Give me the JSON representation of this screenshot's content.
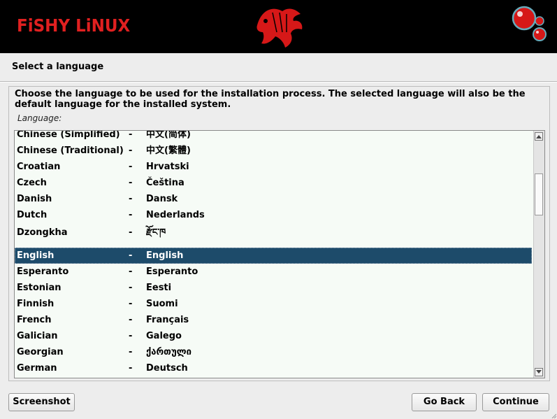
{
  "banner": {
    "brand": "FiSHY LiNUX",
    "logo_icon": "betta-fish-icon",
    "bubbles_icon": "bubbles-icon",
    "accent_color": "#e02020"
  },
  "page": {
    "title": "Select a language",
    "description": "Choose the language to be used for the installation process. The selected language will also be the default language for the installed system.",
    "field_label": "Language:"
  },
  "languages": [
    {
      "name": "Chinese (Simplified)",
      "native": "中文(简体)"
    },
    {
      "name": "Chinese (Traditional)",
      "native": "中文(繁體)"
    },
    {
      "name": "Croatian",
      "native": "Hrvatski"
    },
    {
      "name": "Czech",
      "native": "Čeština"
    },
    {
      "name": "Danish",
      "native": "Dansk"
    },
    {
      "name": "Dutch",
      "native": "Nederlands"
    },
    {
      "name": "Dzongkha",
      "native": "རྫོང་ཁ"
    },
    {
      "name": "English",
      "native": "English",
      "selected": true
    },
    {
      "name": "Esperanto",
      "native": "Esperanto"
    },
    {
      "name": "Estonian",
      "native": "Eesti"
    },
    {
      "name": "Finnish",
      "native": "Suomi"
    },
    {
      "name": "French",
      "native": "Français"
    },
    {
      "name": "Galician",
      "native": "Galego"
    },
    {
      "name": "Georgian",
      "native": "ქართული"
    },
    {
      "name": "German",
      "native": "Deutsch"
    }
  ],
  "separator": "-",
  "selection_color": "#1d4b6a",
  "buttons": {
    "screenshot": "Screenshot",
    "go_back": "Go Back",
    "continue": "Continue"
  }
}
